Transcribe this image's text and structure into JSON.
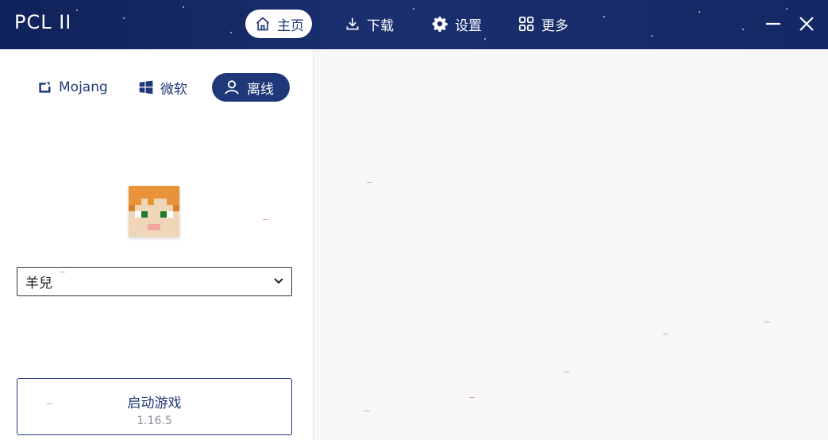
{
  "app": {
    "title": "PCL II"
  },
  "nav": [
    {
      "label": "主页",
      "icon": "home-icon",
      "active": true
    },
    {
      "label": "下载",
      "icon": "download-icon",
      "active": false
    },
    {
      "label": "设置",
      "icon": "gear-icon",
      "active": false
    },
    {
      "label": "更多",
      "icon": "grid-icon",
      "active": false
    }
  ],
  "login_tabs": [
    {
      "label": "Mojang",
      "icon": "mojang-icon",
      "active": false
    },
    {
      "label": "微软",
      "icon": "windows-icon",
      "active": false
    },
    {
      "label": "离线",
      "icon": "user-icon",
      "active": true
    }
  ],
  "account": {
    "selected": "羊兒"
  },
  "launch": {
    "label": "启动游戏",
    "version": "1.16.5"
  },
  "colors": {
    "accent": "#1f3879",
    "titlebar": "#142866"
  }
}
